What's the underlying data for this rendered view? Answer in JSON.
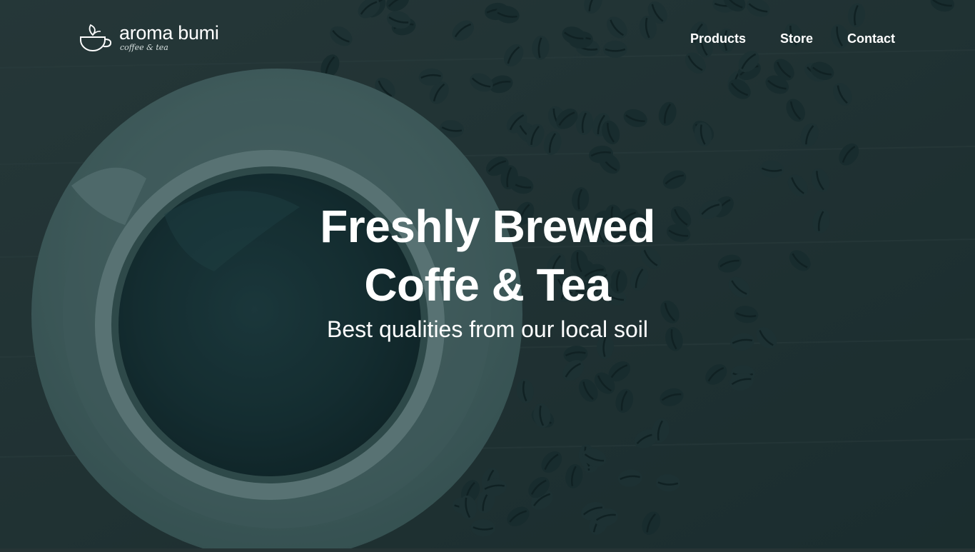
{
  "brand": {
    "name": "aroma bumi",
    "tagline": "coffee & tea"
  },
  "nav": {
    "items": [
      {
        "label": "Products"
      },
      {
        "label": "Store"
      },
      {
        "label": "Contact"
      }
    ]
  },
  "hero": {
    "headline_line1": "Freshly Brewed",
    "headline_line2": "Coffe & Tea",
    "subheadline": "Best qualities from our local soil"
  },
  "colors": {
    "overlay": "#143034",
    "text": "#ffffff",
    "background": "#263435"
  }
}
